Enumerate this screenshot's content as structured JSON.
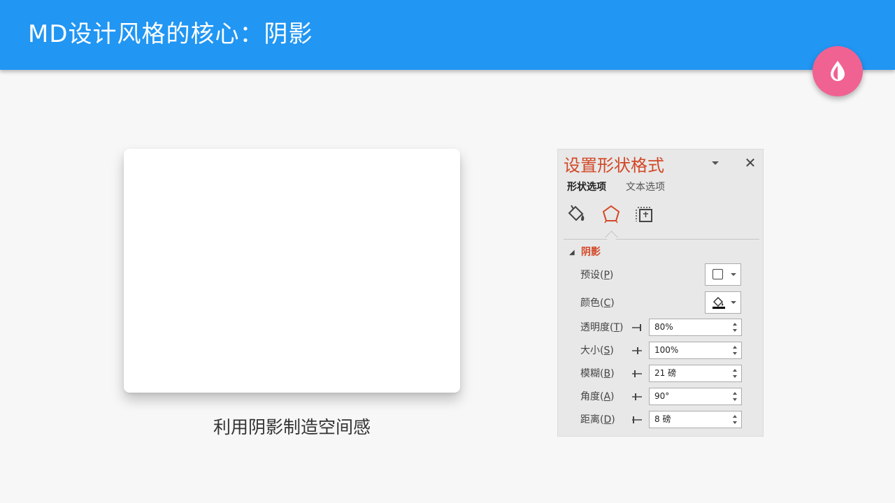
{
  "header": {
    "title": "MD设计风格的核心：阴影"
  },
  "fab": {
    "icon": "water-drop-icon",
    "color": "#f06292"
  },
  "colors": {
    "primary": "#2196f3",
    "accent": "#d24726",
    "background": "#f7f7f7"
  },
  "card": {
    "caption": "利用阴影制造空间感"
  },
  "panel": {
    "title": "设置形状格式",
    "tabs": [
      {
        "label": "形状选项",
        "active": true
      },
      {
        "label": "文本选项",
        "active": false
      }
    ],
    "category_icons": [
      "fill-line-icon",
      "pentagon-effects-icon",
      "size-properties-icon"
    ],
    "section": {
      "title": "阴影",
      "expanded": true
    },
    "preset": {
      "label": "预设",
      "hotkey": "P"
    },
    "color": {
      "label": "颜色",
      "hotkey": "C"
    },
    "fields": [
      {
        "label": "透明度",
        "hotkey": "T",
        "value": "80%"
      },
      {
        "label": "大小",
        "hotkey": "S",
        "value": "100%"
      },
      {
        "label": "模糊",
        "hotkey": "B",
        "value": "21 磅"
      },
      {
        "label": "角度",
        "hotkey": "A",
        "value": "90°"
      },
      {
        "label": "距离",
        "hotkey": "D",
        "value": "8 磅"
      }
    ]
  }
}
